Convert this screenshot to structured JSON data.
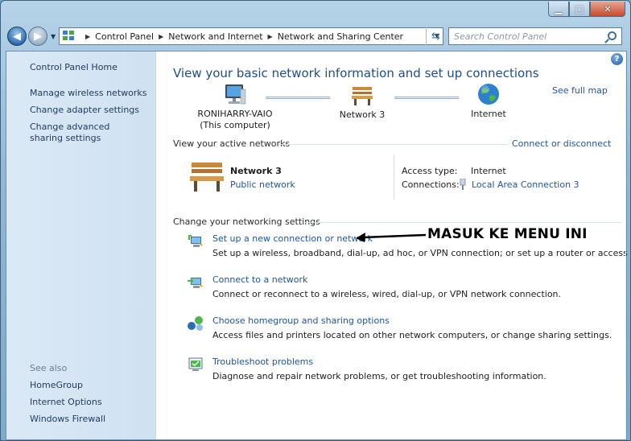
{
  "window": {
    "minimize": "▁",
    "maximize": "□",
    "close": "✕"
  },
  "nav": {
    "back": "◀",
    "forward": "▶",
    "breadcrumbs": [
      "Control Panel",
      "Network and Internet",
      "Network and Sharing Center"
    ],
    "search_placeholder": "Search Control Panel",
    "icons": {
      "back": "back-arrow-icon",
      "forward": "forward-arrow-icon",
      "refresh": "refresh-icon",
      "search": "search-icon",
      "location": "network-folder-icon"
    }
  },
  "sidebar": {
    "home": "Control Panel Home",
    "links": [
      "Manage wireless networks",
      "Change adapter settings",
      "Change advanced sharing settings"
    ],
    "see_also_heading": "See also",
    "see_also": [
      "HomeGroup",
      "Internet Options",
      "Windows Firewall"
    ]
  },
  "main": {
    "title": "View your basic network information and set up connections",
    "see_full_map": "See full map",
    "help": "?",
    "map": {
      "computer_name": "RONIHARRY-VAIO",
      "computer_sub": "(This computer)",
      "network": "Network  3",
      "internet": "Internet"
    },
    "active_networks_heading": "View your active networks",
    "connect_or_disconnect": "Connect or disconnect",
    "active_network": {
      "name": "Network  3",
      "type": "Public network",
      "access_type_label": "Access type:",
      "access_type_value": "Internet",
      "connections_label": "Connections:",
      "connections_value": "Local Area Connection 3"
    },
    "change_settings_heading": "Change your networking settings",
    "tasks": [
      {
        "link": "Set up a new connection or network",
        "desc": "Set up a wireless, broadband, dial-up, ad hoc, or VPN connection; or set up a router or access point.",
        "icon": "new-connection-icon"
      },
      {
        "link": "Connect to a network",
        "desc": "Connect or reconnect to a wireless, wired, dial-up, or VPN network connection.",
        "icon": "connect-network-icon"
      },
      {
        "link": "Choose homegroup and sharing options",
        "desc": "Access files and printers located on other network computers, or change sharing settings.",
        "icon": "homegroup-icon"
      },
      {
        "link": "Troubleshoot problems",
        "desc": "Diagnose and repair network problems, or get troubleshooting information.",
        "icon": "troubleshoot-icon"
      }
    ],
    "annotation": "MASUK KE MENU INI"
  },
  "colors": {
    "link": "#1d56a8",
    "title": "#1e4e8c",
    "sidebar_bg": "#d6e6f5"
  }
}
